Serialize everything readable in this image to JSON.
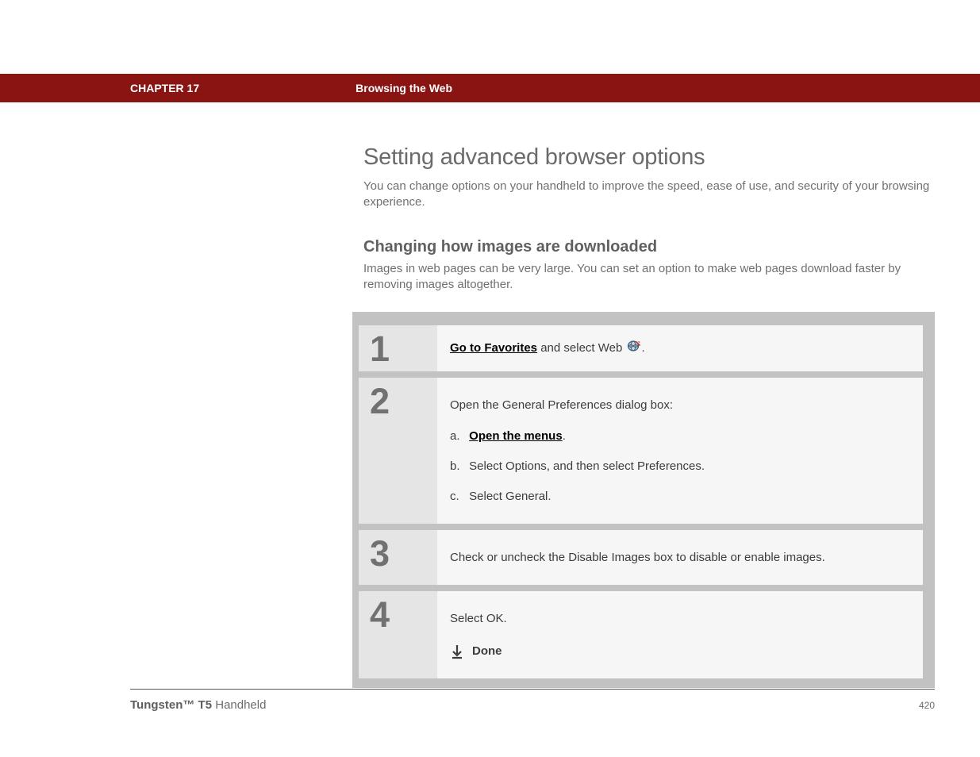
{
  "header": {
    "chapter": "CHAPTER 17",
    "title": "Browsing the Web"
  },
  "main": {
    "title": "Setting advanced browser options",
    "intro": "You can change options on your handheld to improve the speed, ease of use, and security of your browsing experience.",
    "subsection": {
      "title": "Changing how images are downloaded",
      "text": "Images in web pages can be very large. You can set an option to make web pages download faster by removing images altogether."
    }
  },
  "steps": [
    {
      "num": "1",
      "link_text": "Go to Favorites",
      "after_link": " and select Web ",
      "trailing_period": "."
    },
    {
      "num": "2",
      "intro": "Open the General Preferences dialog box:",
      "subs": [
        {
          "marker": "a.",
          "link": "Open the menus",
          "after": "."
        },
        {
          "marker": "b.",
          "text": "Select Options, and then select Preferences."
        },
        {
          "marker": "c.",
          "text": "Select General."
        }
      ]
    },
    {
      "num": "3",
      "text": "Check or uncheck the Disable Images box to disable or enable images."
    },
    {
      "num": "4",
      "text": "Select OK.",
      "done_label": "Done"
    }
  ],
  "footer": {
    "product_bold": "Tungsten™ T5",
    "product_rest": " Handheld",
    "page": "420"
  }
}
